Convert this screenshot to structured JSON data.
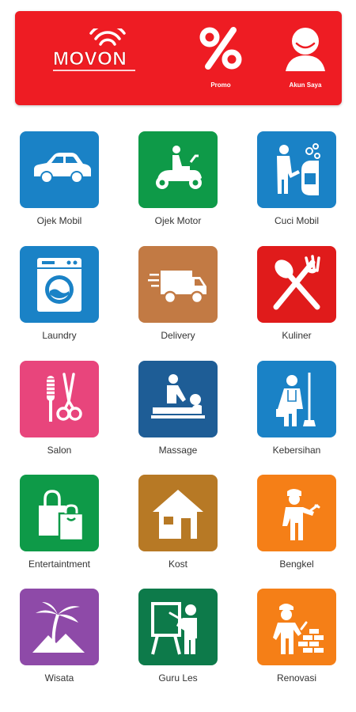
{
  "header": {
    "brand": "MOVON",
    "promo_label": "Promo",
    "account_label": "Akun Saya"
  },
  "services": [
    {
      "label": "Ojek Mobil",
      "color": "#1a82c6",
      "icon": "car-icon"
    },
    {
      "label": "Ojek Motor",
      "color": "#0e9a48",
      "icon": "scooter-icon"
    },
    {
      "label": "Cuci Mobil",
      "color": "#1a82c6",
      "icon": "car-wash-icon"
    },
    {
      "label": "Laundry",
      "color": "#1a82c6",
      "icon": "washing-machine-icon"
    },
    {
      "label": "Delivery",
      "color": "#c27a44",
      "icon": "delivery-truck-icon"
    },
    {
      "label": "Kuliner",
      "color": "#e01b1b",
      "icon": "fork-spoon-icon"
    },
    {
      "label": "Salon",
      "color": "#e8457c",
      "icon": "comb-scissors-icon"
    },
    {
      "label": "Massage",
      "color": "#1e5d96",
      "icon": "massage-icon"
    },
    {
      "label": "Kebersihan",
      "color": "#1a82c6",
      "icon": "cleaner-icon"
    },
    {
      "label": "Entertaintment",
      "color": "#0e9a48",
      "icon": "shopping-bags-icon"
    },
    {
      "label": "Kost",
      "color": "#b77925",
      "icon": "house-icon"
    },
    {
      "label": "Bengkel",
      "color": "#f57f17",
      "icon": "mechanic-icon"
    },
    {
      "label": "Wisata",
      "color": "#8e4aa8",
      "icon": "palm-tree-icon"
    },
    {
      "label": "Guru Les",
      "color": "#0d7a4a",
      "icon": "teacher-icon"
    },
    {
      "label": "Renovasi",
      "color": "#f57f17",
      "icon": "builder-icon"
    }
  ]
}
